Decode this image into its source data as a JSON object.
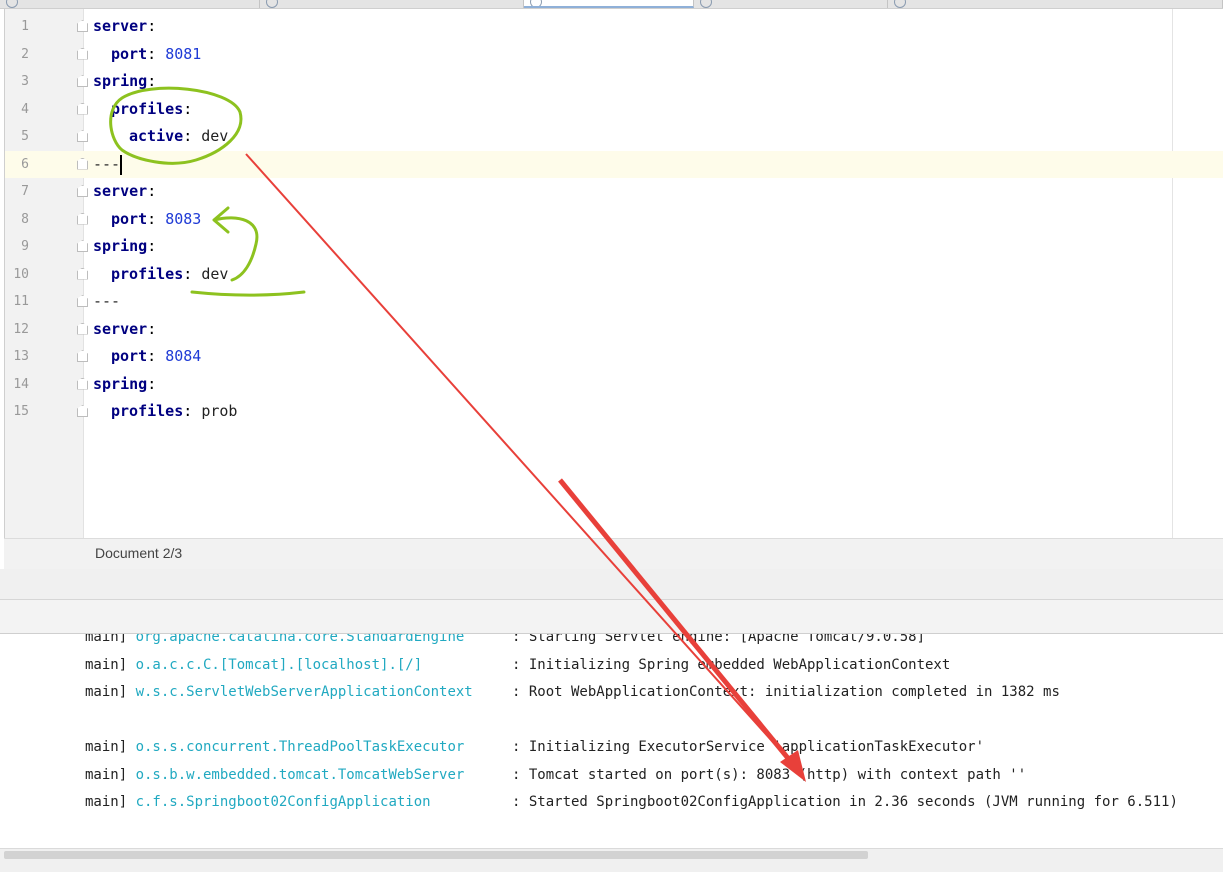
{
  "editor": {
    "lines": [
      {
        "num": "1",
        "key": "server",
        "sep": ":",
        "val": "",
        "valtype": "",
        "indent": 0
      },
      {
        "num": "2",
        "key": "port",
        "sep": ": ",
        "val": "8081",
        "valtype": "num",
        "indent": 1
      },
      {
        "num": "3",
        "key": "spring",
        "sep": ":",
        "val": "",
        "valtype": "",
        "indent": 0
      },
      {
        "num": "4",
        "key": "profiles",
        "sep": ":",
        "val": "",
        "valtype": "",
        "indent": 1
      },
      {
        "num": "5",
        "key": "active",
        "sep": ": ",
        "val": "dev",
        "valtype": "str",
        "indent": 2
      },
      {
        "num": "6",
        "key": "",
        "sep": "",
        "val": "---",
        "valtype": "str",
        "indent": 0
      },
      {
        "num": "7",
        "key": "server",
        "sep": ":",
        "val": "",
        "valtype": "",
        "indent": 0
      },
      {
        "num": "8",
        "key": "port",
        "sep": ": ",
        "val": "8083",
        "valtype": "num",
        "indent": 1
      },
      {
        "num": "9",
        "key": "spring",
        "sep": ":",
        "val": "",
        "valtype": "",
        "indent": 0
      },
      {
        "num": "10",
        "key": "profiles",
        "sep": ": ",
        "val": "dev",
        "valtype": "str",
        "indent": 1
      },
      {
        "num": "11",
        "key": "",
        "sep": "",
        "val": "---",
        "valtype": "str",
        "indent": 0
      },
      {
        "num": "12",
        "key": "server",
        "sep": ":",
        "val": "",
        "valtype": "",
        "indent": 0
      },
      {
        "num": "13",
        "key": "port",
        "sep": ": ",
        "val": "8084",
        "valtype": "num",
        "indent": 1
      },
      {
        "num": "14",
        "key": "spring",
        "sep": ":",
        "val": "",
        "valtype": "",
        "indent": 0
      },
      {
        "num": "15",
        "key": "profiles",
        "sep": ": ",
        "val": "prob",
        "valtype": "str",
        "indent": 1
      }
    ],
    "current_line": 6
  },
  "status": {
    "document_label": "Document 2/3"
  },
  "console": {
    "lines": [
      {
        "thread": "main]",
        "logger": "org.apache.catalina.core.StandardEngine",
        "message": ": Starting Servlet engine: [Apache Tomcat/9.0.58]"
      },
      {
        "thread": "main]",
        "logger": "o.a.c.c.C.[Tomcat].[localhost].[/]",
        "message": ": Initializing Spring embedded WebApplicationContext"
      },
      {
        "thread": "main]",
        "logger": "w.s.c.ServletWebServerApplicationContext",
        "message": ": Root WebApplicationContext: initialization completed in 1382 ms"
      },
      {
        "thread": "",
        "logger": "",
        "message": ""
      },
      {
        "thread": "main]",
        "logger": "o.s.s.concurrent.ThreadPoolTaskExecutor",
        "message": ": Initializing ExecutorService 'applicationTaskExecutor'"
      },
      {
        "thread": "main]",
        "logger": "o.s.b.w.embedded.tomcat.TomcatWebServer",
        "message": ": Tomcat started on port(s): 8083 (http) with context path ''"
      },
      {
        "thread": "main]",
        "logger": "c.f.s.Springboot02ConfigApplication",
        "message": ": Started Springboot02ConfigApplication in 2.36 seconds (JVM running for 6.511)"
      }
    ]
  },
  "colors": {
    "annotation_green": "#8dc21f",
    "annotation_red": "#e8403a",
    "key": "#000080",
    "number": "#1f3bd6",
    "logger": "#21a9c1"
  }
}
